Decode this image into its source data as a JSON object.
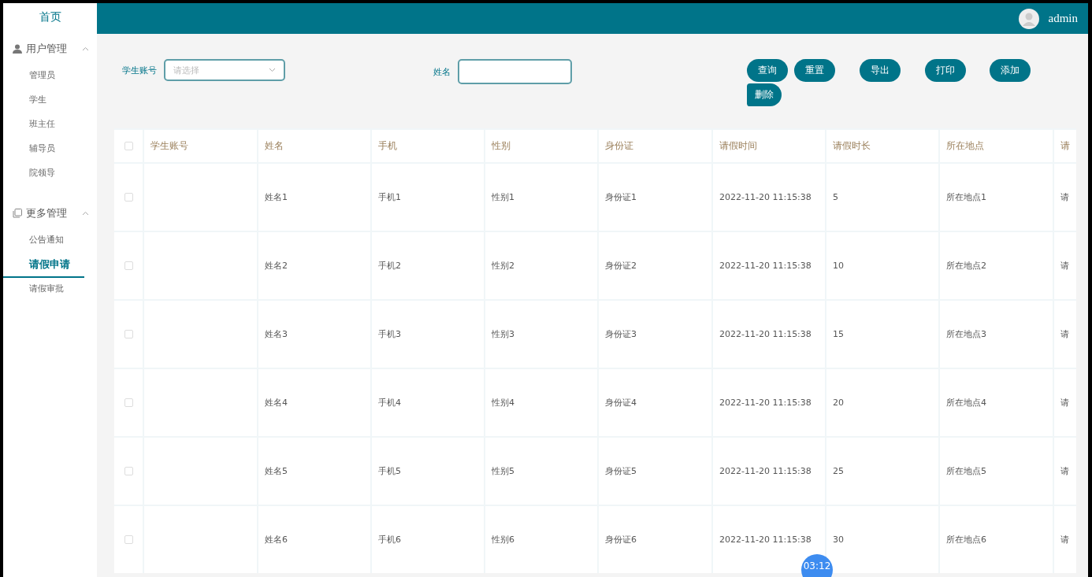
{
  "sidebar": {
    "home": "首页",
    "groups": [
      {
        "title": "用户管理",
        "expanded": true,
        "items": [
          {
            "label": "管理员",
            "selected": false
          },
          {
            "label": "学生",
            "selected": false
          },
          {
            "label": "班主任",
            "selected": false
          },
          {
            "label": "辅导员",
            "selected": false
          },
          {
            "label": "院领导",
            "selected": false
          }
        ]
      },
      {
        "title": "更多管理",
        "expanded": true,
        "items": [
          {
            "label": "公告通知",
            "selected": false
          },
          {
            "label": "请假申请",
            "selected": true
          },
          {
            "label": "请假审批",
            "selected": false
          }
        ]
      }
    ]
  },
  "header": {
    "user": "admin"
  },
  "search": {
    "fields": [
      {
        "label": "学生账号",
        "kind": "select",
        "placeholder": "请选择"
      },
      {
        "label": "姓名",
        "kind": "text"
      }
    ],
    "buttons": [
      "查询",
      "重置",
      "导出",
      "打印",
      "添加",
      "删除"
    ]
  },
  "table": {
    "all_checked": false,
    "columns": [
      "学生账号",
      "姓名",
      "手机",
      "性别",
      "身份证",
      "请假时间",
      "请假时长",
      "所在地点",
      "请"
    ],
    "rows": [
      {
        "checked": false,
        "cells": [
          "",
          "姓名1",
          "手机1",
          "性别1",
          "身份证1",
          "2022-11-20 11:15:38",
          "5",
          "所在地点1",
          "请"
        ]
      },
      {
        "checked": false,
        "cells": [
          "",
          "姓名2",
          "手机2",
          "性别2",
          "身份证2",
          "2022-11-20 11:15:38",
          "10",
          "所在地点2",
          "请"
        ]
      },
      {
        "checked": false,
        "cells": [
          "",
          "姓名3",
          "手机3",
          "性别3",
          "身份证3",
          "2022-11-20 11:15:38",
          "15",
          "所在地点3",
          "请"
        ]
      },
      {
        "checked": false,
        "cells": [
          "",
          "姓名4",
          "手机4",
          "性别4",
          "身份证4",
          "2022-11-20 11:15:38",
          "20",
          "所在地点4",
          "请"
        ]
      },
      {
        "checked": false,
        "cells": [
          "",
          "姓名5",
          "手机5",
          "性别5",
          "身份证5",
          "2022-11-20 11:15:38",
          "25",
          "所在地点5",
          "请"
        ]
      },
      {
        "checked": false,
        "cells": [
          "",
          "姓名6",
          "手机6",
          "性别6",
          "身份证6",
          "2022-11-20 11:15:38",
          "30",
          "所在地点6",
          "请"
        ]
      }
    ]
  },
  "timer": "03:12"
}
